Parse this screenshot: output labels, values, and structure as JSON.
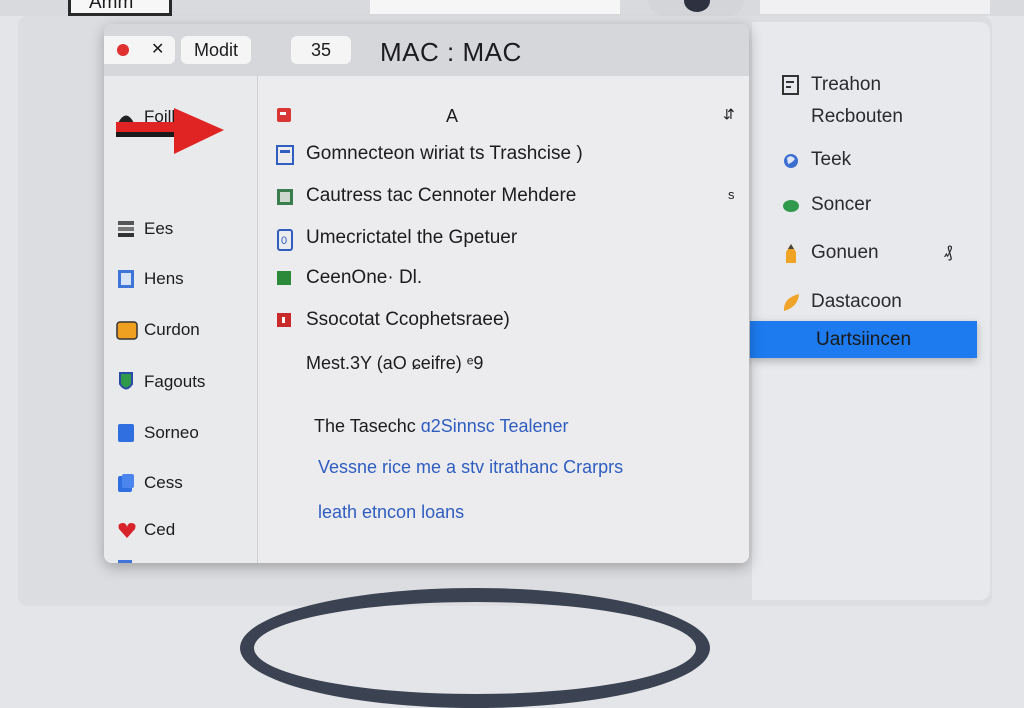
{
  "background": {
    "top_card_label": "Amm"
  },
  "window": {
    "mode_label": "Modit",
    "count_label": "35",
    "title": "MAC : MAC",
    "content_header": "A",
    "sidebar": {
      "items": [
        {
          "label": "Foilh"
        },
        {
          "label": "Ees"
        },
        {
          "label": "Hens"
        },
        {
          "label": "Curdon"
        },
        {
          "label": "Fagouts"
        },
        {
          "label": "Sorneo"
        },
        {
          "label": "Cess"
        },
        {
          "label": "Ced"
        },
        {
          "label": ""
        }
      ]
    },
    "rows": [
      {
        "label": "Gomnecteon wiriat ts Trashcise )"
      },
      {
        "label": "Cautress tac Cennoter Mehdere",
        "trailing": "s"
      },
      {
        "label": "Umecrictatel the Gpetuer"
      },
      {
        "label": "CeenOne· Dl."
      },
      {
        "label": "Ssocotat Ccophetsraee)"
      }
    ],
    "meta_line": "Mest.3Y (aO ɕeifre) ᵉ9",
    "heading_line": {
      "bold": "The Tasechc",
      "link": "ɑ2Sinnsc Tealener"
    },
    "links": [
      "Vessne rice me a stv itrathanc Crarprs",
      "leath etncon loans"
    ]
  },
  "right_panel": {
    "items": [
      {
        "label": "Treahon"
      },
      {
        "label": "Recbouten"
      },
      {
        "label": "Teek"
      },
      {
        "label": "Soncer"
      },
      {
        "label": "Gonuen",
        "trailing": "₰"
      },
      {
        "label": "Dastacoon"
      }
    ],
    "selected_label": "Uartsiincen"
  },
  "colors": {
    "accent": "#1d7bef",
    "arrow": "#e02424",
    "link": "#2f5dc0"
  }
}
